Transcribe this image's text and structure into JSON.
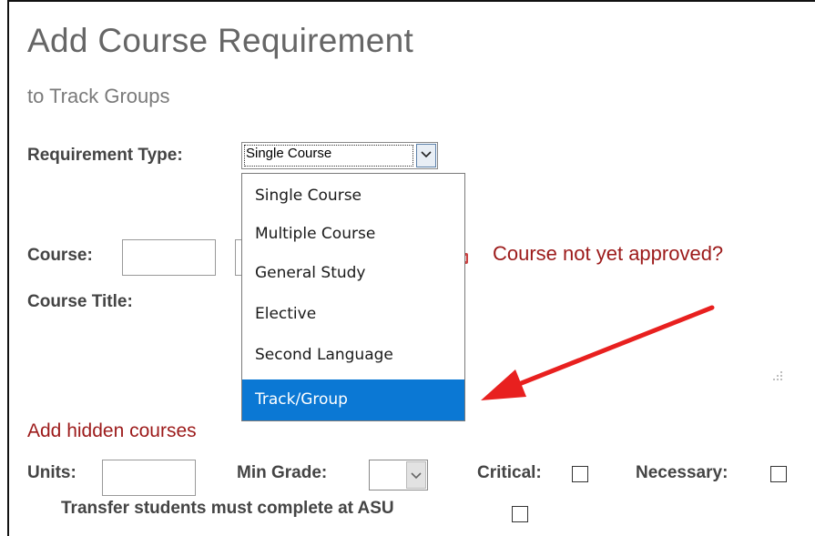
{
  "header": {
    "title": "Add Course Requirement",
    "subtitle": "to Track Groups"
  },
  "form": {
    "requirement_type_label": "Requirement Type:",
    "requirement_type_value": "Single Course",
    "course_label": "Course:",
    "course_title_label": "Course Title:",
    "course_not_approved_link": "Course not yet approved?",
    "add_hidden_courses_link": "Add hidden courses",
    "units_label": "Units:",
    "min_grade_label": "Min Grade:",
    "critical_label": "Critical:",
    "necessary_label": "Necessary:",
    "transfer_label": "Transfer students must complete at ASU"
  },
  "dropdown": {
    "options": [
      "Single Course",
      "Multiple Course",
      "General Study",
      "Elective",
      "Second Language",
      "Track/Group"
    ],
    "highlighted": "Track/Group"
  },
  "colors": {
    "highlight": "#0b78d4",
    "link_red": "#9c1a1a",
    "annotation_arrow": "#e8201f"
  }
}
